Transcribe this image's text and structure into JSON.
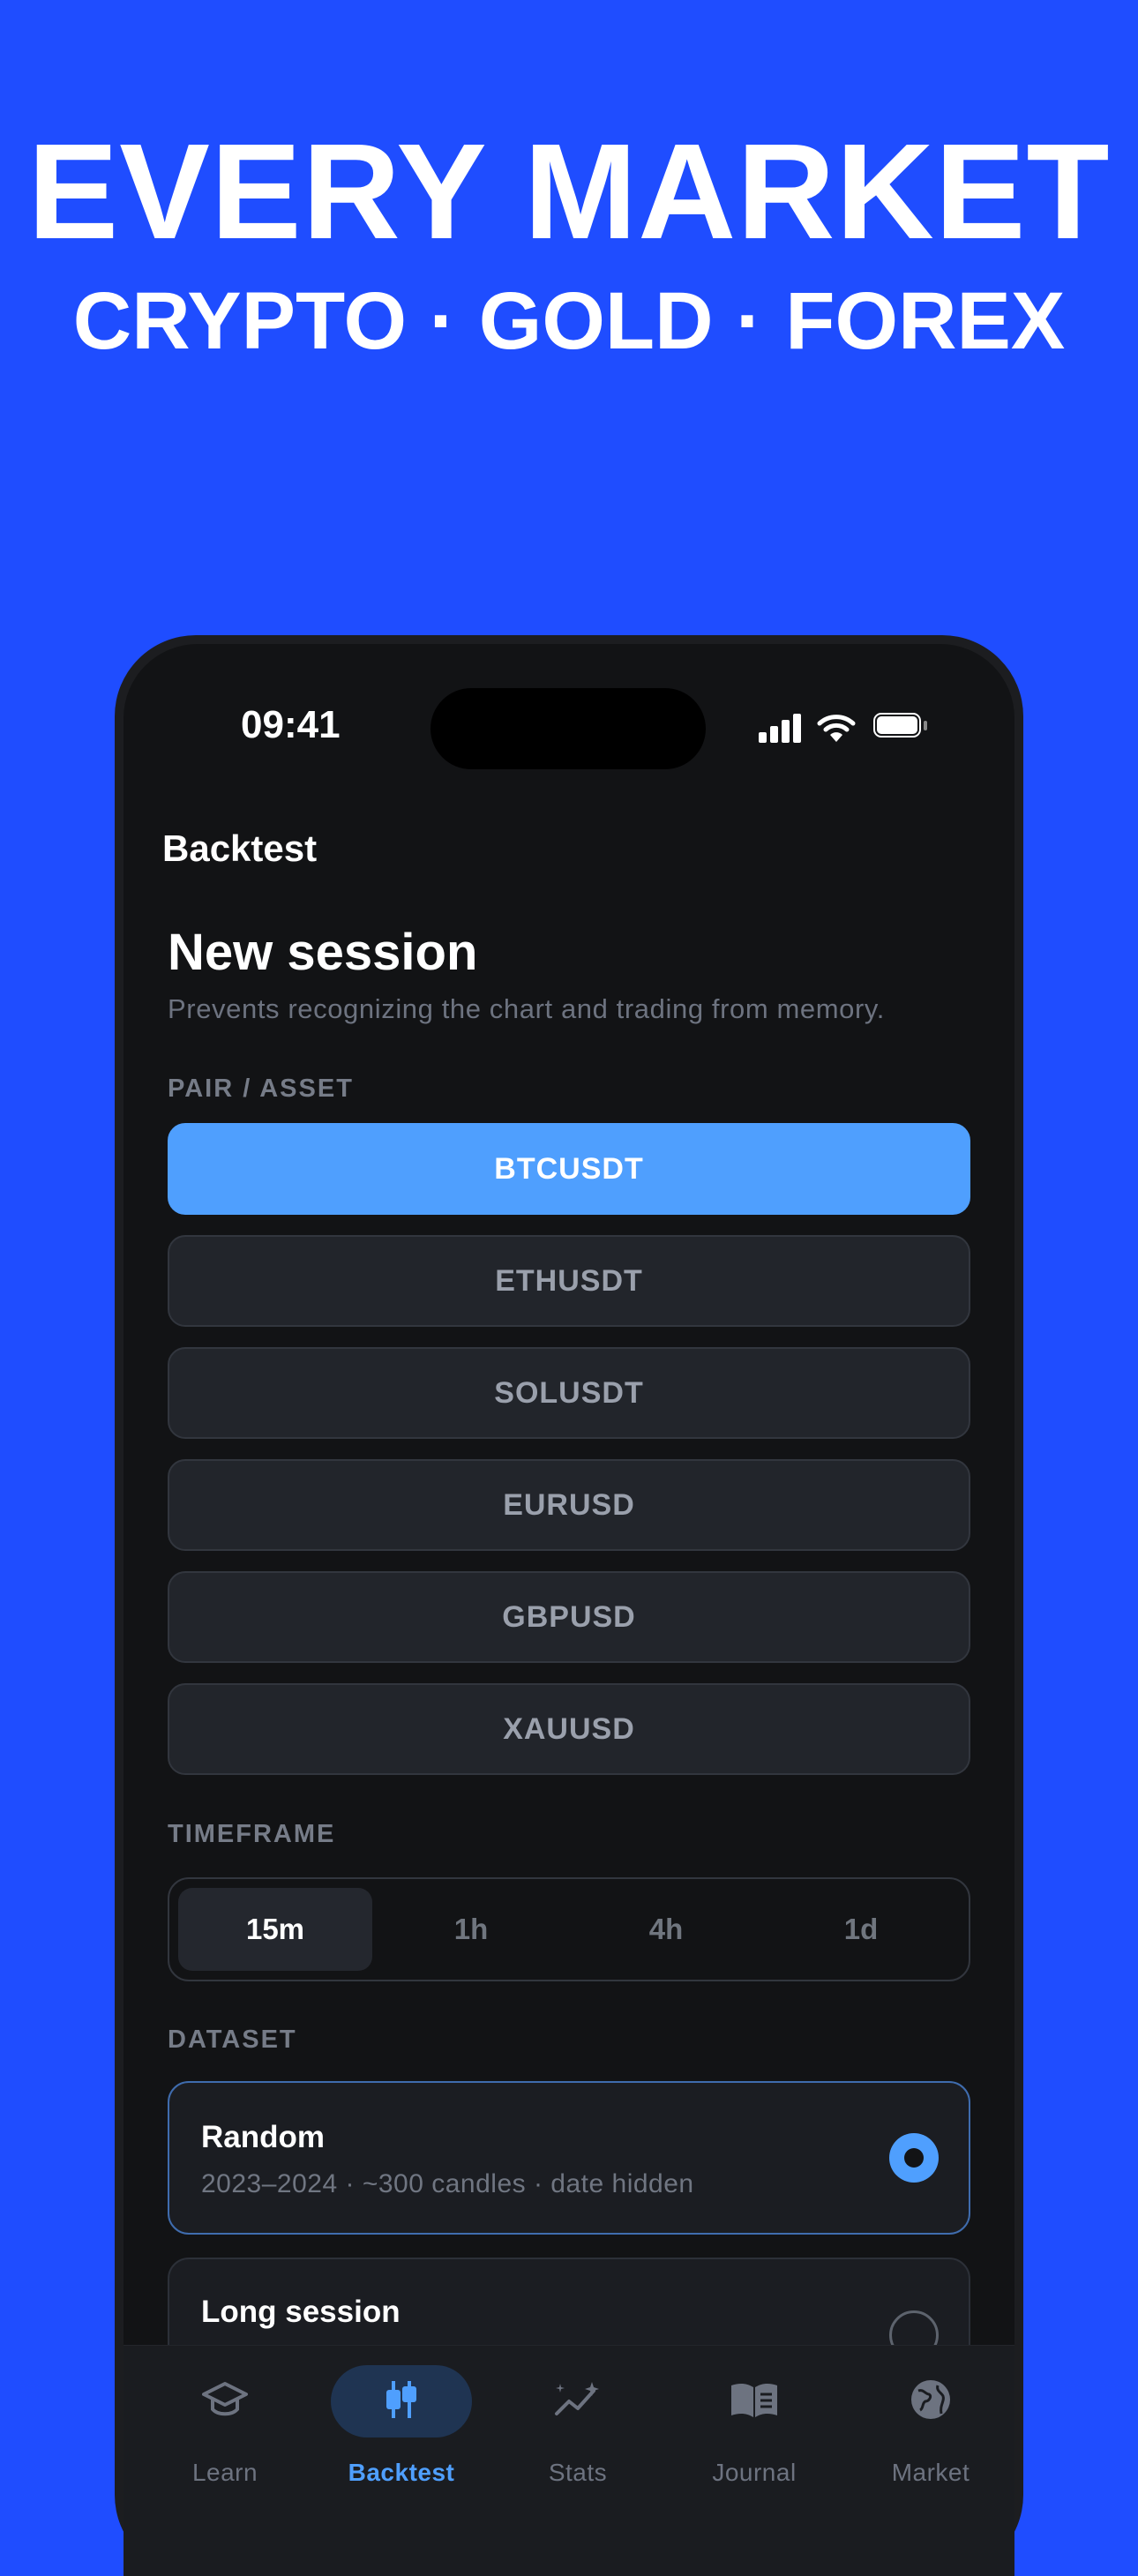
{
  "hero": {
    "headline": "EVERY MARKET",
    "subline": "CRYPTO · GOLD · FOREX"
  },
  "status_bar": {
    "time": "09:41"
  },
  "nav": {
    "title": "Backtest"
  },
  "session": {
    "title": "New session",
    "description": "Prevents recognizing the chart and trading from memory."
  },
  "pair": {
    "label": "PAIR / ASSET",
    "options": [
      "BTCUSDT",
      "ETHUSDT",
      "SOLUSDT",
      "EURUSD",
      "GBPUSD",
      "XAUUSD"
    ],
    "selected": "BTCUSDT"
  },
  "timeframe": {
    "label": "TIMEFRAME",
    "options": [
      "15m",
      "1h",
      "4h",
      "1d"
    ],
    "selected": "15m"
  },
  "dataset": {
    "label": "DATASET",
    "options": [
      {
        "title": "Random",
        "description": "2023–2024 · ~300 candles · date hidden",
        "selected": true
      },
      {
        "title": "Long session",
        "description": "",
        "selected": false
      }
    ]
  },
  "tabbar": {
    "items": [
      {
        "label": "Learn",
        "icon": "graduation-cap-icon"
      },
      {
        "label": "Backtest",
        "icon": "candlestick-icon"
      },
      {
        "label": "Stats",
        "icon": "chart-sparkle-icon"
      },
      {
        "label": "Journal",
        "icon": "book-icon"
      },
      {
        "label": "Market",
        "icon": "globe-icon"
      }
    ],
    "active": "Backtest"
  },
  "colors": {
    "background": "#1f4dff",
    "accent": "#4f9ffe",
    "screen": "#121315"
  }
}
